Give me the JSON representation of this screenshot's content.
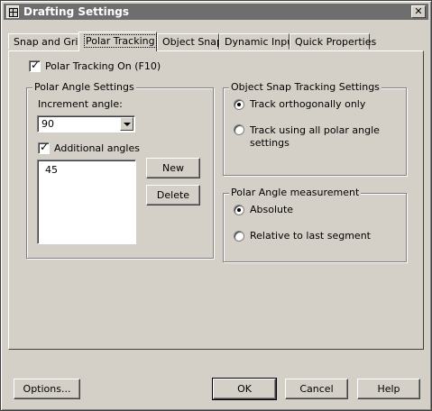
{
  "window": {
    "title": "Drafting Settings"
  },
  "tabs": [
    "Snap and Grid",
    "Polar Tracking",
    "Object Snap",
    "Dynamic Input",
    "Quick Properties"
  ],
  "polar_tracking_on": {
    "label": "Polar Tracking On (F10)",
    "checked": true
  },
  "polar_angle_settings": {
    "title": "Polar Angle Settings",
    "increment_label": "Increment angle:",
    "increment_value": "90",
    "additional_angles_label": "Additional angles",
    "additional_checked": true,
    "angles": [
      "45"
    ],
    "new_button": "New",
    "delete_button": "Delete"
  },
  "object_snap_tracking": {
    "title": "Object Snap Tracking Settings",
    "option1": "Track orthogonally only",
    "option2_line1": "Track using all polar angle",
    "option2_line2": "settings",
    "selected": "option1"
  },
  "polar_angle_measurement": {
    "title": "Polar Angle measurement",
    "option1": "Absolute",
    "option2": "Relative to last segment",
    "selected": "option1"
  },
  "buttons": {
    "options": "Options...",
    "ok": "OK",
    "cancel": "Cancel",
    "help": "Help"
  },
  "colors": {
    "face": "#d4d0c8",
    "titlebar": "#6e6e6e"
  },
  "icons": {
    "title_icon": "drafting-settings-icon",
    "close_icon": "close-icon"
  }
}
